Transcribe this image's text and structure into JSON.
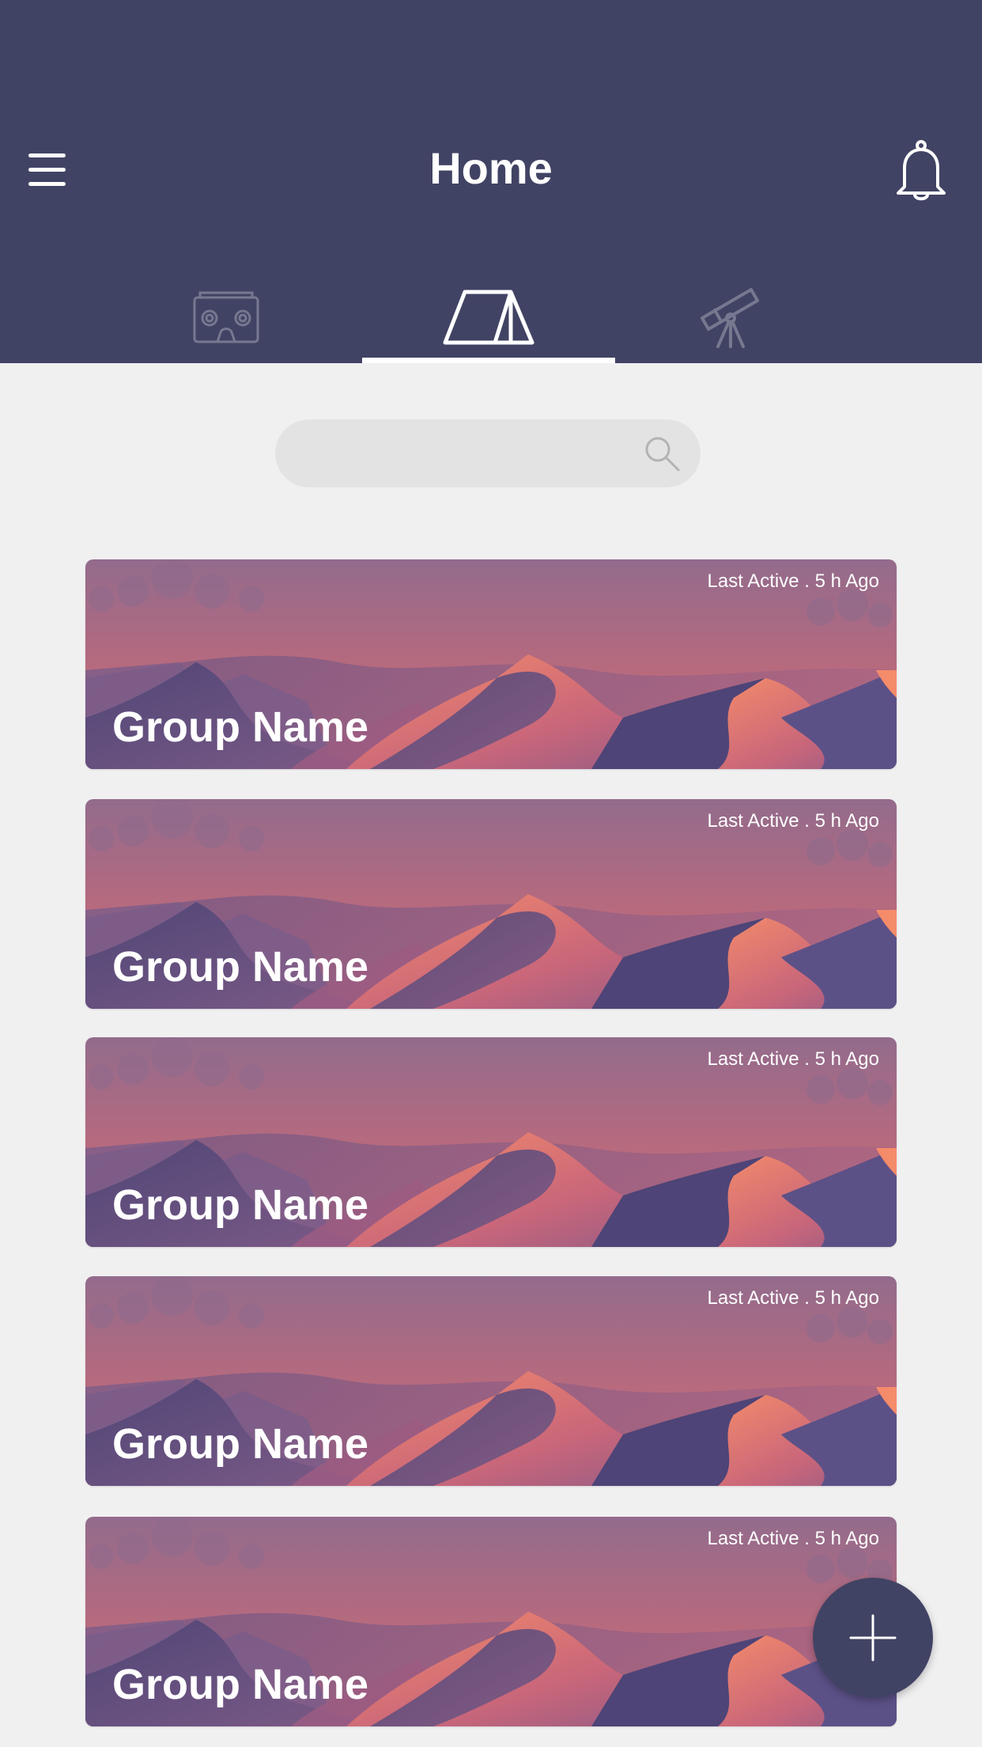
{
  "header": {
    "title": "Home",
    "background": "#414364"
  },
  "icons": {
    "menu": "menu-icon",
    "notifications": "bell-icon",
    "search": "search-icon",
    "add": "plus-icon"
  },
  "tabs": [
    {
      "icon": "vr-headset-icon",
      "active": false
    },
    {
      "icon": "tent-icon",
      "active": true
    },
    {
      "icon": "telescope-icon",
      "active": false
    }
  ],
  "search": {
    "value": "",
    "placeholder": ""
  },
  "groups": [
    {
      "name": "Group Name",
      "last_active": "Last Active . 5 h Ago"
    },
    {
      "name": "Group Name",
      "last_active": "Last Active . 5 h Ago"
    },
    {
      "name": "Group Name",
      "last_active": "Last Active . 5 h Ago"
    },
    {
      "name": "Group Name",
      "last_active": "Last Active . 5 h Ago"
    },
    {
      "name": "Group Name",
      "last_active": "Last Active . 5 h Ago"
    }
  ],
  "colors": {
    "accent": "#414364",
    "page_background": "#f1f0f1",
    "card_sky_top": "#936b8c",
    "card_sky_bottom": "#d16e78"
  }
}
